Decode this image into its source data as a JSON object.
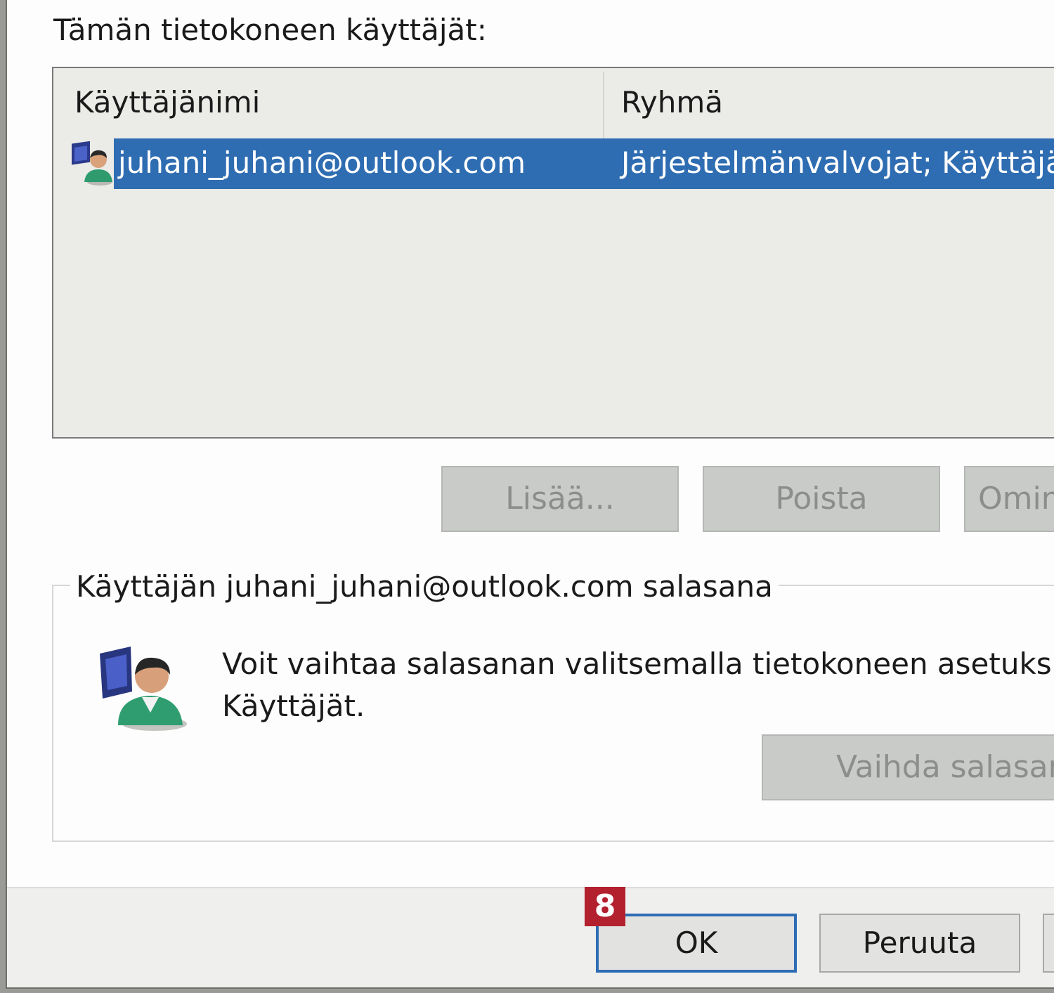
{
  "dialog": {
    "users_label": "Tämän tietokoneen käyttäjät:",
    "columns": {
      "username": "Käyttäjänimi",
      "group": "Ryhmä"
    },
    "users": [
      {
        "username": "juhani_juhani@outlook.com",
        "group": "Järjestelmänvalvojat; Käyttäjät",
        "icon": "user-admin-icon",
        "selected": true
      }
    ],
    "buttons": {
      "add": "Lisää...",
      "remove": "Poista",
      "properties": "Omin"
    },
    "password_group": {
      "legend": "Käyttäjän juhani_juhani@outlook.com salasana",
      "text_line1": "Voit vaihtaa salasanan valitsemalla tietokoneen asetuksissa",
      "text_line2": "Käyttäjät.",
      "change_button": "Vaihda salasana",
      "icon": "user-admin-icon"
    },
    "footer": {
      "ok": "OK",
      "cancel": "Peruuta"
    }
  },
  "annotation": {
    "step_number": "8",
    "color": "#b3202e"
  },
  "colors": {
    "selection": "#2f6db2",
    "focus_border": "#2d6db5",
    "disabled_button": "#c9cbc8"
  }
}
